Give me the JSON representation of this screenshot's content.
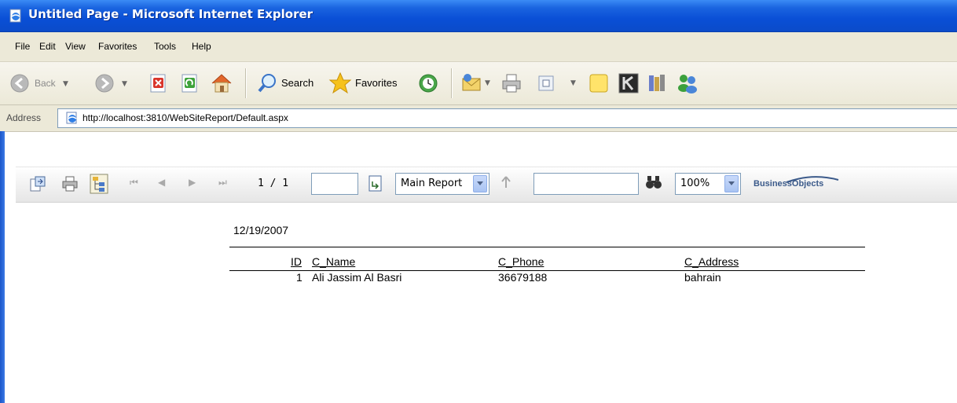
{
  "window": {
    "title": "Untitled Page - Microsoft Internet Explorer"
  },
  "menu": {
    "items": [
      "File",
      "Edit",
      "View",
      "Favorites",
      "Tools",
      "Help"
    ]
  },
  "toolbar": {
    "back_label": "Back",
    "search_label": "Search",
    "favorites_label": "Favorites"
  },
  "address": {
    "label": "Address",
    "url": "http://localhost:3810/WebSiteReport/Default.aspx"
  },
  "report_viewer": {
    "page_count": "1 / 1",
    "goto_page_value": "",
    "group_selected": "Main Report",
    "search_value": "",
    "zoom_selected": "100%",
    "vendor_logo_text": "BusinessObjects"
  },
  "report": {
    "date": "12/19/2007",
    "columns": [
      "ID",
      "C_Name",
      "C_Phone",
      "C_Address"
    ],
    "rows": [
      [
        "1",
        "Ali Jassim Al Basri",
        "36679188",
        "bahrain"
      ]
    ]
  },
  "colors": {
    "titlebar": "#0a4fd6",
    "chrome": "#ece9d8"
  }
}
